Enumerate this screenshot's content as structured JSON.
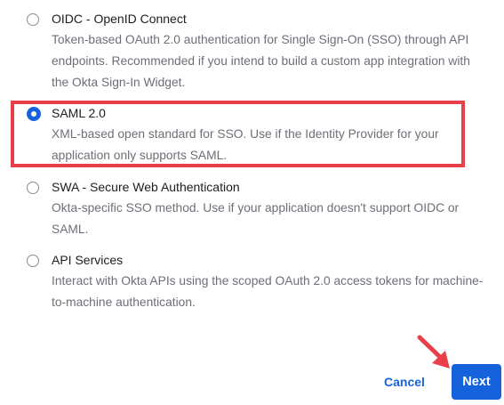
{
  "options": [
    {
      "label": "OIDC - OpenID Connect",
      "description": "Token-based OAuth 2.0 authentication for Single Sign-On (SSO) through API endpoints. Recommended if you intend to build a custom app integration with the Okta Sign-In Widget.",
      "selected": false
    },
    {
      "label": "SAML 2.0",
      "description": "XML-based open standard for SSO. Use if the Identity Provider for your application only supports SAML.",
      "selected": true
    },
    {
      "label": "SWA - Secure Web Authentication",
      "description": "Okta-specific SSO method. Use if your application doesn't support OIDC or SAML.",
      "selected": false
    },
    {
      "label": "API Services",
      "description": "Interact with Okta APIs using the scoped OAuth 2.0 access tokens for machine-to-machine authentication.",
      "selected": false
    }
  ],
  "footer": {
    "cancel_label": "Cancel",
    "next_label": "Next"
  },
  "colors": {
    "accent": "#1662dd",
    "highlight": "#e8404a",
    "label_text": "#1d1d21",
    "description_text": "#6e6e78"
  },
  "icons": {
    "annotation_arrow": "arrow-pointing-icon"
  }
}
